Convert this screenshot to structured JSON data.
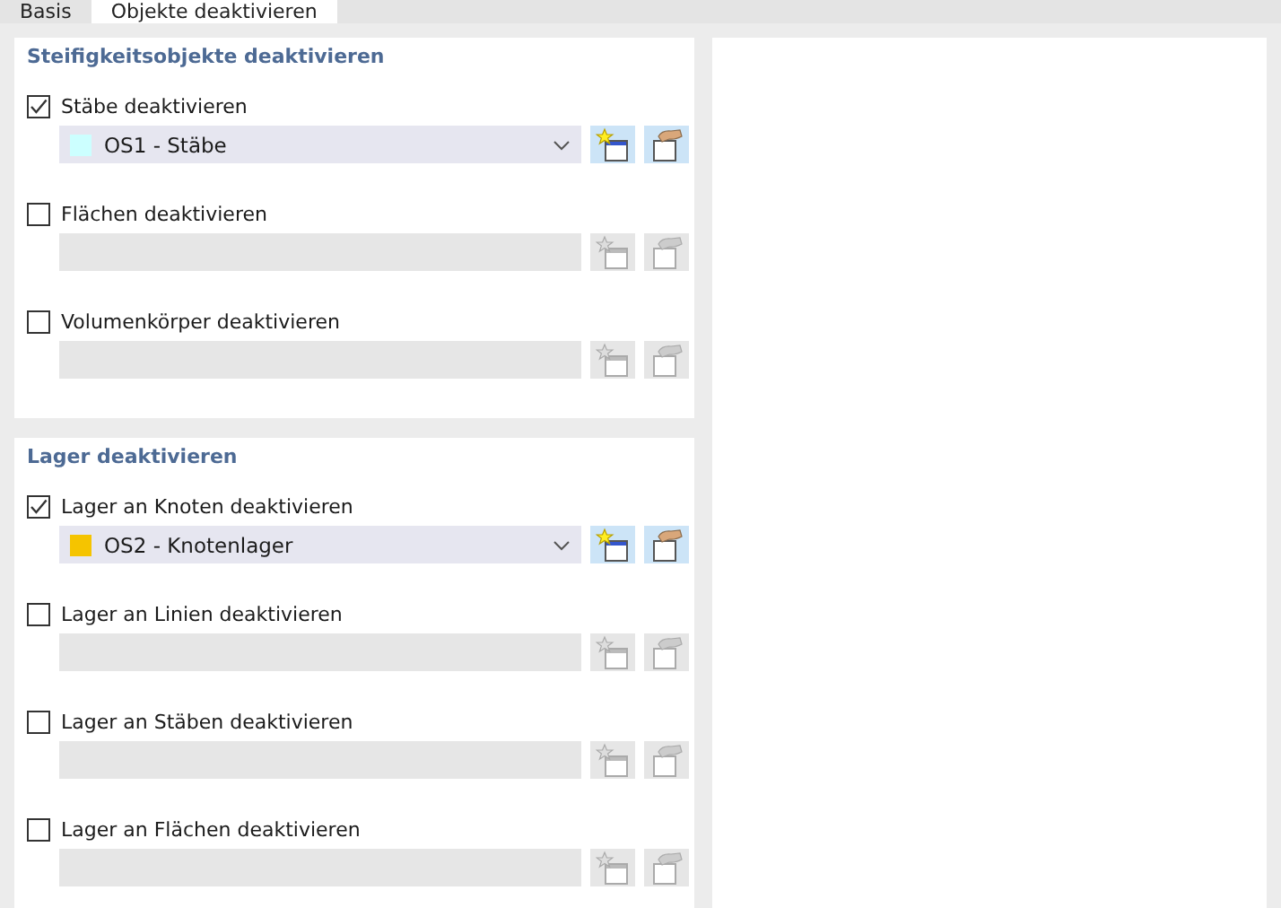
{
  "tabs": [
    {
      "label": "Basis",
      "selected": false
    },
    {
      "label": "Objekte deaktivieren",
      "selected": true
    }
  ],
  "groups": [
    {
      "title": "Steifigkeitsobjekte deaktivieren",
      "options": [
        {
          "label": "Stäbe deaktivieren",
          "checked": true,
          "selection": {
            "text": "OS1 - Stäbe",
            "color": "#ccffff"
          }
        },
        {
          "label": "Flächen deaktivieren",
          "checked": false
        },
        {
          "label": "Volumenkörper deaktivieren",
          "checked": false
        }
      ]
    },
    {
      "title": "Lager deaktivieren",
      "options": [
        {
          "label": "Lager an Knoten deaktivieren",
          "checked": true,
          "selection": {
            "text": "OS2 - Knotenlager",
            "color": "#f5c400"
          }
        },
        {
          "label": "Lager an Linien deaktivieren",
          "checked": false
        },
        {
          "label": "Lager an Stäben deaktivieren",
          "checked": false
        },
        {
          "label": "Lager an Flächen deaktivieren",
          "checked": false
        }
      ]
    }
  ]
}
